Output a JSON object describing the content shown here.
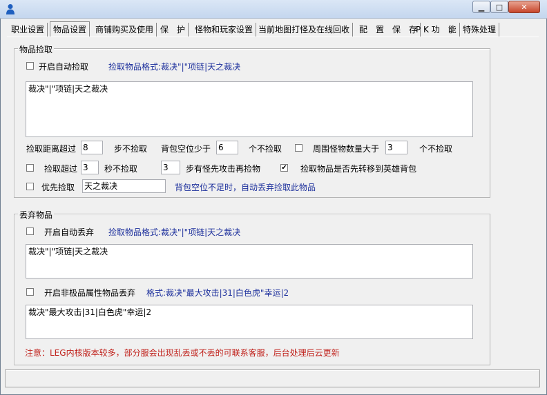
{
  "window": {
    "title": "",
    "minimize_glyph": "▁",
    "maximize_glyph": "□",
    "close_glyph": "✕"
  },
  "tabs": [
    {
      "label": "职业设置"
    },
    {
      "label": "物品设置"
    },
    {
      "label": "商铺购买及使用"
    },
    {
      "label": "保　护"
    },
    {
      "label": "怪物和玩家设置"
    },
    {
      "label": "当前地图打怪及在线回收"
    },
    {
      "label": "配　置　保　存"
    },
    {
      "label": "P K 功　能"
    },
    {
      "label": "特殊处理"
    }
  ],
  "active_tab": "物品设置",
  "pickup": {
    "group_title": "物品捡取",
    "auto_pickup_label": "开启自动捡取",
    "auto_pickup_checked": false,
    "format_hint": "捡取物品格式:裁决\"|\"项链|天之裁决",
    "list_text": "裁决\"|\"项链|天之裁决",
    "distance_label_pre": "捡取距离超过",
    "distance_value": "8",
    "distance_label_post": "步不捡取",
    "bag_label_pre": "背包空位少于",
    "bag_value": "6",
    "bag_label_post": "个不捡取",
    "monster_label_pre": "周围怪物数量大于",
    "monster_checked": false,
    "monster_value": "3",
    "monster_label_post": "个不捡取",
    "timeout_label_pre": "捡取超过",
    "timeout_checked": false,
    "timeout_value": "3",
    "timeout_label_post": "秒不捡取",
    "steps_value": "3",
    "steps_label": "步有怪先攻击再捡物",
    "transfer_label": "捡取物品是否先转移到英雄背包",
    "transfer_checked": true,
    "priority_label": "优先捡取",
    "priority_checked": false,
    "priority_value": "天之裁决",
    "bag_full_hint": "背包空位不足时，自动丢弃捡取此物品"
  },
  "discard": {
    "group_title": "丢弃物品",
    "auto_discard_label": "开启自动丢弃",
    "auto_discard_checked": false,
    "format_hint": "捡取物品格式:裁决\"|\"项链|天之裁决",
    "list_text": "裁决\"|\"项链|天之裁决",
    "nonpremium_label": "开启非极品属性物品丢弃",
    "nonpremium_checked": false,
    "nonpremium_hint": "格式:裁决\"最大攻击|31|白色虎\"幸运|2",
    "nonpremium_text": "裁决\"最大攻击|31|白色虎\"幸运|2"
  },
  "notice": "注意：LEG内核版本较多，部分服会出现乱丢或不丢的可联系客服，后台处理后云更新",
  "colors": {
    "hint_blue": "#1c2f9c",
    "notice_red": "#c0201a"
  }
}
